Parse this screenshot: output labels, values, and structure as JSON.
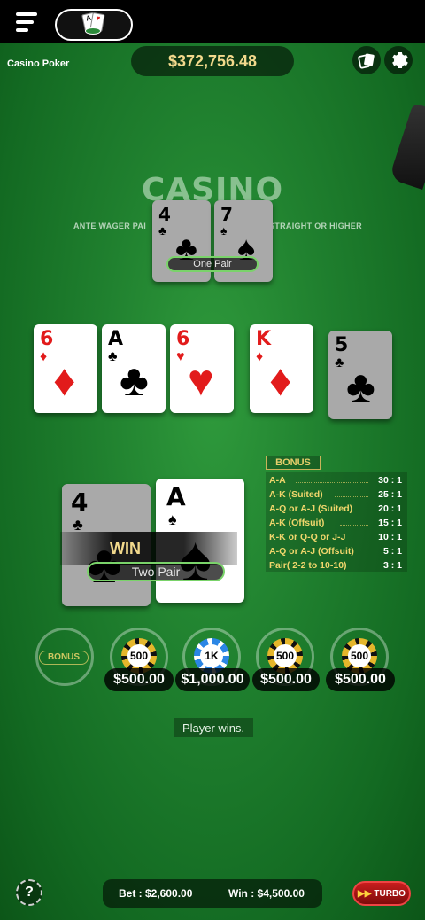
{
  "app": {
    "title": "Casino Poker",
    "balance": "$372,756.48"
  },
  "table": {
    "logo": "CASINO",
    "rule_left": "ANTE WAGER PAI",
    "rule_right": "STRAIGHT OR HIGHER"
  },
  "dealer_hand": {
    "cards": [
      {
        "rank": "4",
        "suit": "♣",
        "color": "black"
      },
      {
        "rank": "7",
        "suit": "♠",
        "color": "black"
      }
    ],
    "label": "One Pair"
  },
  "community_cards": [
    {
      "rank": "6",
      "suit": "♦",
      "color": "red"
    },
    {
      "rank": "A",
      "suit": "♣",
      "color": "black"
    },
    {
      "rank": "6",
      "suit": "♥",
      "color": "red"
    },
    {
      "rank": "K",
      "suit": "♦",
      "color": "red"
    },
    {
      "rank": "5",
      "suit": "♣",
      "color": "black"
    }
  ],
  "player_hand": {
    "cards": [
      {
        "rank": "4",
        "suit": "♣",
        "color": "black"
      },
      {
        "rank": "A",
        "suit": "♠",
        "color": "black"
      }
    ],
    "result": "WIN",
    "label": "Two Pair"
  },
  "bonus": {
    "title": "BONUS",
    "rows": [
      {
        "hand": "A-A",
        "payout": "30 : 1"
      },
      {
        "hand": "A-K (Suited)",
        "payout": "25 : 1"
      },
      {
        "hand": "A-Q or A-J (Suited)",
        "payout": "20 : 1"
      },
      {
        "hand": "A-K (Offsuit)",
        "payout": "15 : 1"
      },
      {
        "hand": "K-K or Q-Q or J-J",
        "payout": "10 : 1"
      },
      {
        "hand": "A-Q or A-J (Offsuit)",
        "payout": "5 : 1"
      },
      {
        "hand": "Pair( 2-2 to 10-10)",
        "payout": "3 : 1"
      }
    ]
  },
  "bets": {
    "bonus_label": "BONUS",
    "spots": [
      {
        "chip": "500",
        "amount": "$500.00",
        "chip_color": "#e5b62b"
      },
      {
        "chip": "1K",
        "amount": "$1,000.00",
        "chip_color": "#2b86e5"
      },
      {
        "chip": "500",
        "amount": "$500.00",
        "chip_color": "#e5b62b"
      },
      {
        "chip": "500",
        "amount": "$500.00",
        "chip_color": "#e5b62b"
      }
    ]
  },
  "status": "Player wins.",
  "footer": {
    "bet": "Bet : $2,600.00",
    "win": "Win : $4,500.00",
    "turbo": "TURBO",
    "help": "?"
  },
  "icons": {
    "menu": "menu-icon",
    "game": "cards-icon",
    "history": "card-history-icon",
    "settings": "gear-icon"
  },
  "colors": {
    "felt": "#1f7f2e",
    "gold_text": "#f2d98c",
    "label_border": "#7ad36a",
    "turbo": "#c81d1d"
  }
}
